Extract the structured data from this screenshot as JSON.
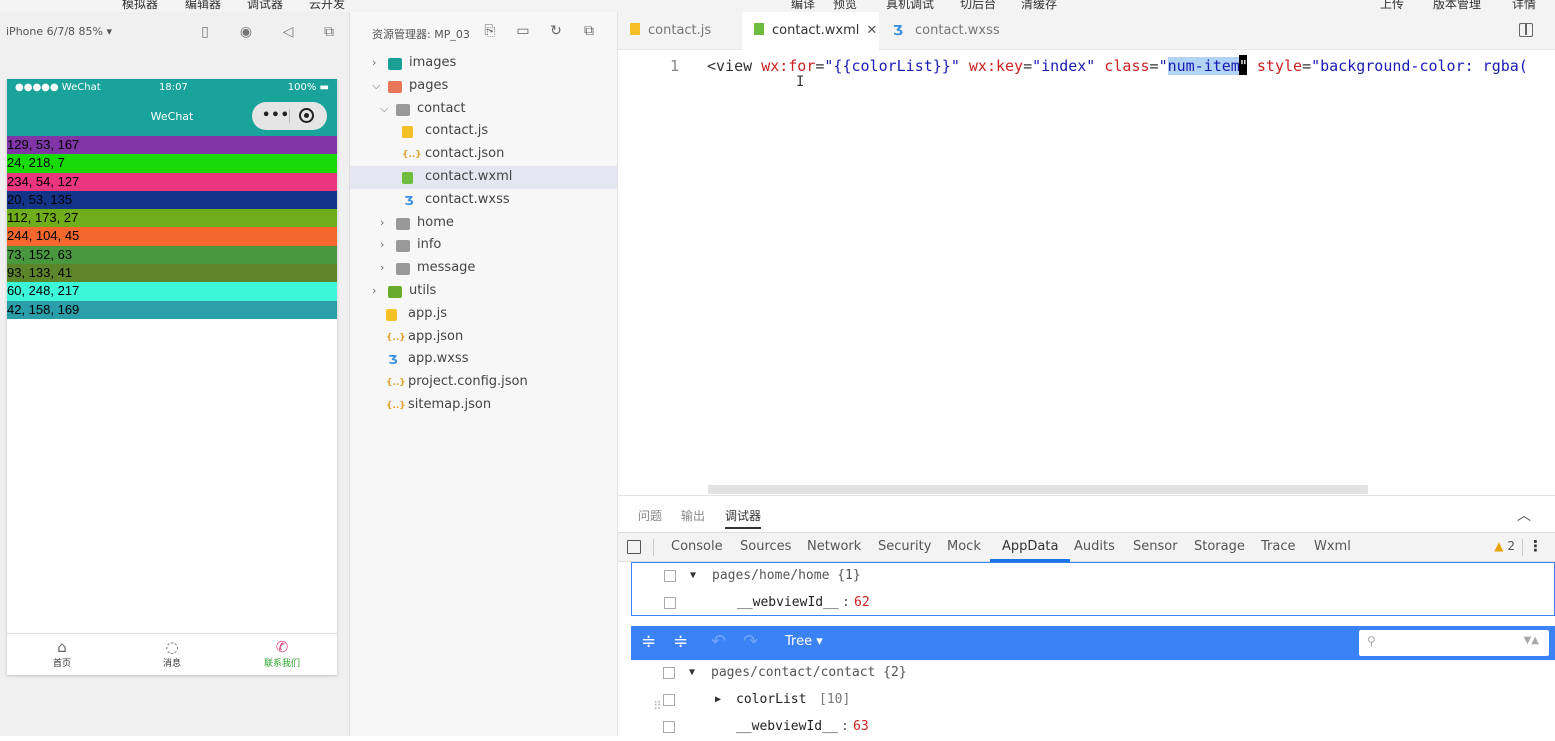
{
  "topbar": {
    "menu": [
      "模拟器",
      "编辑器",
      "调试器",
      "云开发"
    ],
    "right_menu": [
      "编译",
      "预览",
      "真机调试",
      "切后台",
      "清缓存"
    ],
    "far_right": [
      "上传",
      "版本管理",
      "详情"
    ]
  },
  "simulator": {
    "device_label": "iPhone 6/7/8 85% ▾",
    "status_left": "●●●●● WeChat",
    "status_time": "18:07",
    "status_battery": "100%",
    "nav_title": "WeChat",
    "rows": [
      {
        "label": "129, 53, 167",
        "color": "#8135a7"
      },
      {
        "label": "24, 218, 7",
        "color": "#18da07"
      },
      {
        "label": "234, 54, 127",
        "color": "#ea367f"
      },
      {
        "label": "20, 53, 135",
        "color": "#143587"
      },
      {
        "label": "112, 173, 27",
        "color": "#70ad1b"
      },
      {
        "label": "244, 104, 45",
        "color": "#f4682d"
      },
      {
        "label": "73, 152, 63",
        "color": "#49983f"
      },
      {
        "label": "93, 133, 41",
        "color": "#5d8529"
      },
      {
        "label": "60, 248, 217",
        "color": "#3cf8d9"
      },
      {
        "label": "42, 158, 169",
        "color": "#2a9ea9"
      }
    ],
    "tabbar": [
      {
        "label": "首页",
        "icon": "home-icon"
      },
      {
        "label": "消息",
        "icon": "message-icon"
      },
      {
        "label": "联系我们",
        "icon": "phone-icon"
      }
    ]
  },
  "explorer": {
    "title": "资源管理器: MP_03",
    "items": [
      {
        "name": "images",
        "depth": 0,
        "type": "folder-teal",
        "chevron": "›"
      },
      {
        "name": "pages",
        "depth": 0,
        "type": "folder-red",
        "chevron": "⌄"
      },
      {
        "name": "contact",
        "depth": 1,
        "type": "folder",
        "chevron": "⌄"
      },
      {
        "name": "contact.js",
        "depth": 2,
        "type": "js"
      },
      {
        "name": "contact.json",
        "depth": 2,
        "type": "json"
      },
      {
        "name": "contact.wxml",
        "depth": 2,
        "type": "wxml",
        "selected": true
      },
      {
        "name": "contact.wxss",
        "depth": 2,
        "type": "wxss"
      },
      {
        "name": "home",
        "depth": 1,
        "type": "folder",
        "chevron": "›"
      },
      {
        "name": "info",
        "depth": 1,
        "type": "folder",
        "chevron": "›"
      },
      {
        "name": "message",
        "depth": 1,
        "type": "folder",
        "chevron": "›"
      },
      {
        "name": "utils",
        "depth": 0,
        "type": "folder-green",
        "chevron": "›"
      },
      {
        "name": "app.js",
        "depth": 0,
        "type": "js"
      },
      {
        "name": "app.json",
        "depth": 0,
        "type": "json"
      },
      {
        "name": "app.wxss",
        "depth": 0,
        "type": "wxss"
      },
      {
        "name": "project.config.json",
        "depth": 0,
        "type": "json"
      },
      {
        "name": "sitemap.json",
        "depth": 0,
        "type": "json"
      }
    ]
  },
  "editor": {
    "tabs": [
      {
        "label": "contact.js",
        "type": "js"
      },
      {
        "label": "contact.wxml",
        "type": "wxml",
        "active": true
      },
      {
        "label": "contact.wxss",
        "type": "wxss"
      }
    ],
    "line_number": "1",
    "code": {
      "open": "<view ",
      "attr1": "wx:for",
      "val1": "\"{{colorList}}\"",
      "attr2": "wx:key",
      "val2": "\"index\"",
      "attr3": "class",
      "q": "\"",
      "selected": "num-item",
      "q2": "\"",
      "attr4": "style",
      "val4": "\"background-color: rgba("
    }
  },
  "bottom": {
    "tabs": [
      "问题",
      "输出",
      "调试器"
    ],
    "active_tab": "调试器",
    "devtools_tabs": [
      "Console",
      "Sources",
      "Network",
      "Security",
      "Mock",
      "AppData",
      "Audits",
      "Sensor",
      "Storage",
      "Trace",
      "Wxml"
    ],
    "active_devtab": "AppData",
    "warning_count": "2",
    "home_path": "pages/home/home {1}",
    "home_webview_key": "__webviewId__",
    "home_webview_val": "62",
    "tree_mode": "Tree ▾",
    "contact_path": "pages/contact/contact {2}",
    "colorlist_key": "colorList",
    "colorlist_val": "[10]",
    "contact_webview_key": "__webviewId__",
    "contact_webview_val": "63"
  }
}
